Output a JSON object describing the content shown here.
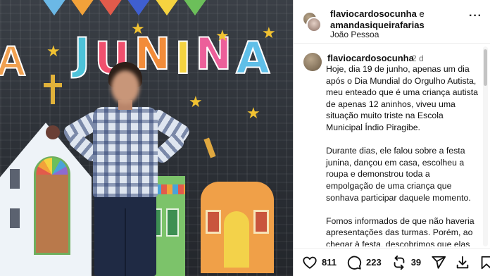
{
  "photo": {
    "banner_text": "JUNINA",
    "banner_letters": [
      {
        "char": "J",
        "color": "#4ec3d9"
      },
      {
        "char": "U",
        "color": "#f0506e"
      },
      {
        "char": "N",
        "color": "#f28c3a"
      },
      {
        "char": "I",
        "color": "#f5d340"
      },
      {
        "char": "N",
        "color": "#ec5f9a"
      },
      {
        "char": "A",
        "color": "#5fbfe8"
      }
    ],
    "left_letter": "A",
    "flag_colors": [
      "#6bb8e6",
      "#f2a23a",
      "#e25b4b",
      "#3f5fd0",
      "#f5d340",
      "#6cbf5a"
    ]
  },
  "post": {
    "header": {
      "author": "flaviocardosocunha",
      "connector": "e",
      "coauthor": "amandasiqueirafarias",
      "location": "João Pessoa",
      "more_label": "···"
    },
    "caption": {
      "username": "flaviocardosocunha",
      "time": "2 d",
      "paragraphs": [
        "Hoje,  dia 19 de junho, apenas um dia após o Dia Mundial do Orgulho Autista, meu enteado que é uma criança autista de apenas 12 aninhos, viveu uma situação muito triste na Escola Municipal Índio Piragibe.",
        "Durante dias, ele falou sobre a festa junina, dançou em casa, escolheu a roupa e demonstrou toda a empolgação de uma criança que sonhava participar daquele momento.",
        "Fomos informados de que não haveria apresentações das turmas. Porém, ao chegar à festa, descobrimos que elas aconteceriam. Ao questionarmos por"
      ]
    },
    "actions": {
      "likes": "811",
      "comments": "223",
      "reposts": "39"
    }
  }
}
